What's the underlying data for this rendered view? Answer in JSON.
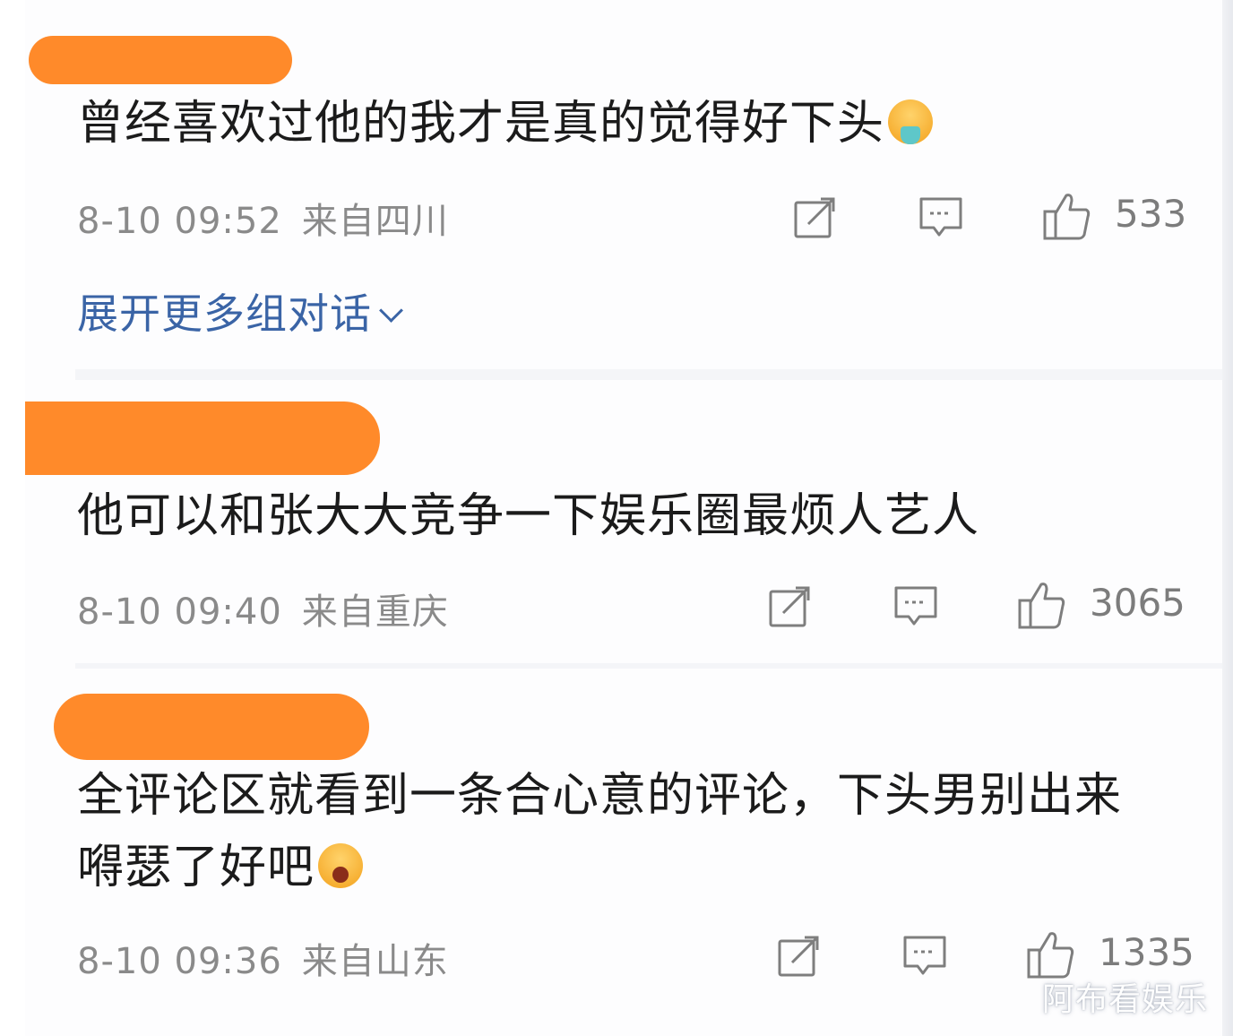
{
  "comments": [
    {
      "text": "曾经喜欢过他的我才是真的觉得好下头",
      "emoji": "vomit-emoji",
      "time": "8-10 09:52",
      "location": "来自四川",
      "likes": "533",
      "expand_label": "展开更多组对话"
    },
    {
      "text": "他可以和张大大竞争一下娱乐圈最烦人艺人",
      "time": "8-10 09:40",
      "location": "来自重庆",
      "likes": "3065"
    },
    {
      "text_line1": "全评论区就看到一条合心意的评论，下头男别出来",
      "text_line2": "嘚瑟了好吧",
      "emoji": "crying-emoji",
      "time": "8-10 09:36",
      "location": "来自山东",
      "likes": "1335"
    }
  ],
  "icons": {
    "share": "share-icon",
    "reply": "comment-icon",
    "like": "thumbs-up-icon"
  },
  "colors": {
    "redaction": "#ff8a2a",
    "link": "#3a64a6",
    "meta": "#8a8a8a"
  },
  "watermark": "阿布看娱乐"
}
